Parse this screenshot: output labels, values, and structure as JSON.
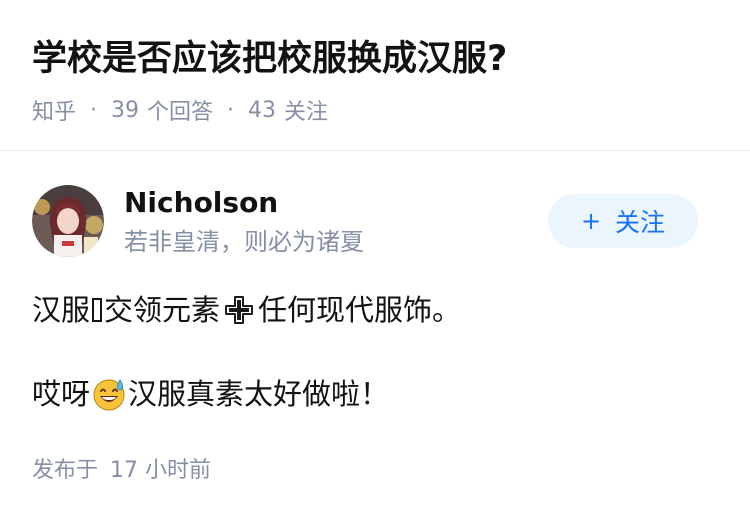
{
  "question": {
    "title": "学校是否应该把校服换成汉服?",
    "source": "知乎",
    "separator": "·",
    "answer_count": "39",
    "answer_label": "个回答",
    "follow_count": "43",
    "follow_label": "关注"
  },
  "author": {
    "name": "Nicholson",
    "bio": "若非皇清，则必为诸夏",
    "follow_plus": "+",
    "follow_label": "关注"
  },
  "answer": {
    "line1_part1": "汉服",
    "line1_part2": "交领元素",
    "line1_part3": "任何现代服饰。",
    "line2_part1": "哎呀",
    "line2_part2": "汉服真素太好做啦！",
    "icons": [
      "missing-glyph-box",
      "heavy-plus-emoji",
      "grinning-sweat-emoji"
    ]
  },
  "meta": {
    "published_label": "发布于",
    "published_time": "17 小时前"
  },
  "colors": {
    "text_primary": "#121212",
    "text_secondary": "#8590a6",
    "follow_bg": "#ebf5fd",
    "follow_text": "#1772f6",
    "divider": "#ebebeb"
  }
}
